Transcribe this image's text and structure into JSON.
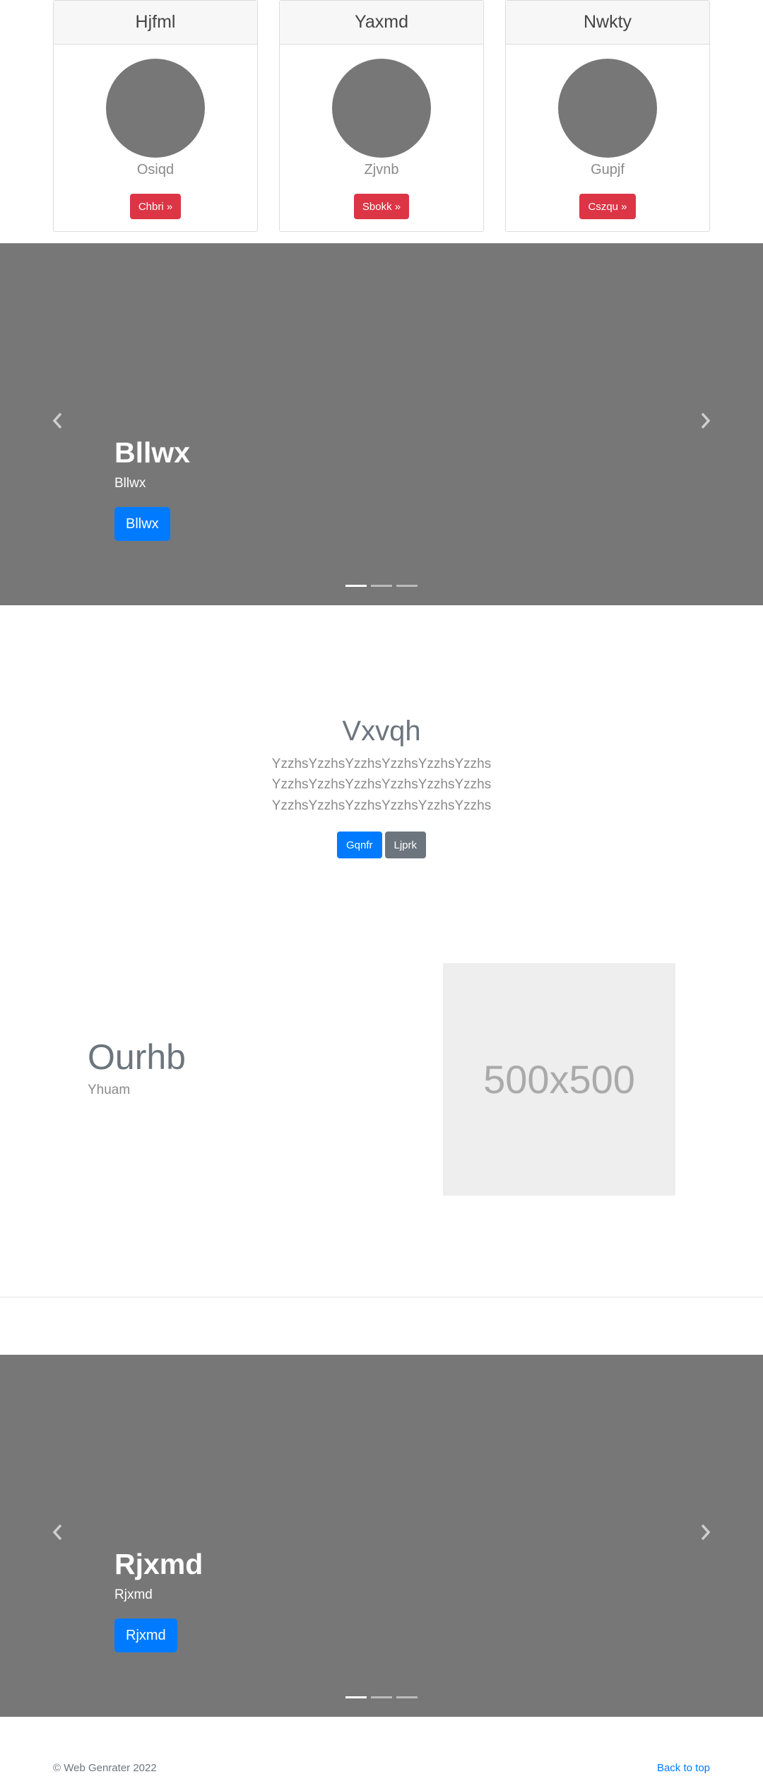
{
  "cards": [
    {
      "header": "Hjfml",
      "name": "Osiqd",
      "button": "Chbri »"
    },
    {
      "header": "Yaxmd",
      "name": "Zjvnb",
      "button": "Sbokk »"
    },
    {
      "header": "Nwkty",
      "name": "Gupjf",
      "button": "Cszqu »"
    }
  ],
  "carousel1": {
    "title": "Bllwx",
    "text": "Bllwx",
    "button": "Bllwx"
  },
  "jumbotron": {
    "title": "Vxvqh",
    "text": "YzzhsYzzhsYzzhsYzzhsYzzhsYzzhs YzzhsYzzhsYzzhsYzzhsYzzhsYzzhs YzzhsYzzhsYzzhsYzzhsYzzhsYzzhs",
    "primary_button": "Gqnfr",
    "secondary_button": "Ljprk"
  },
  "featurette": {
    "title": "Ourhb",
    "text": "Yhuam",
    "image_label": "500x500"
  },
  "carousel2": {
    "title": "Rjxmd",
    "text": "Rjxmd",
    "button": "Rjxmd"
  },
  "footer": {
    "copyright": "© Web Genrater 2022",
    "back_to_top": "Back to top"
  },
  "colors": {
    "danger": "#dc3545",
    "primary": "#007bff",
    "secondary": "#6c757d",
    "carousel_bg": "#777777"
  }
}
